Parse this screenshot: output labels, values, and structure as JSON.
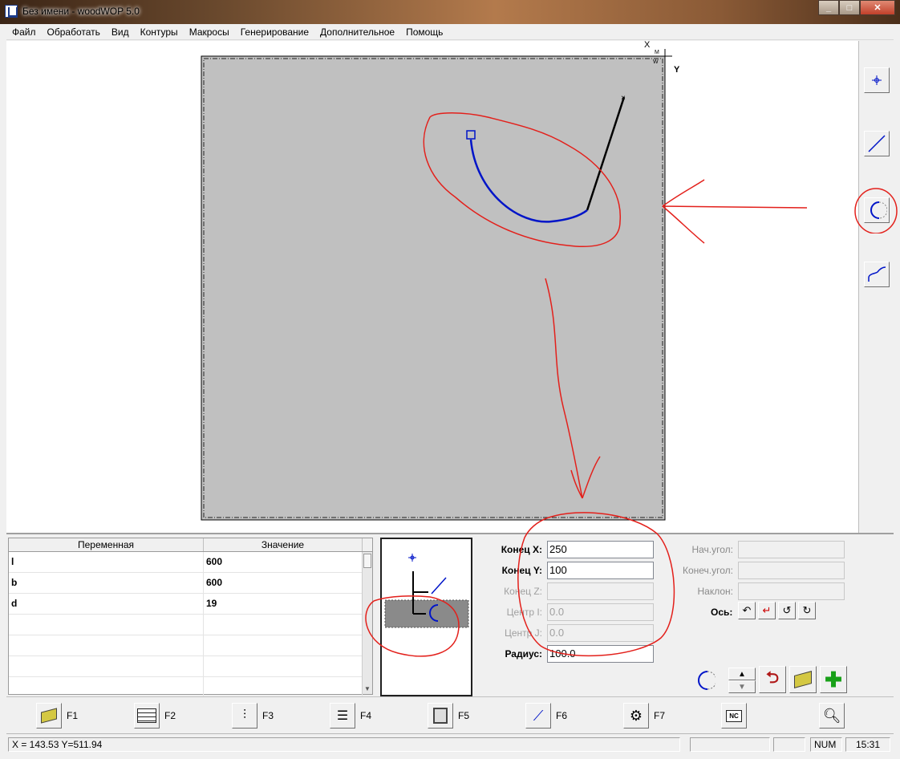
{
  "window": {
    "title": "Без имени - woodWOP 5.0"
  },
  "menu": [
    "Файл",
    "Обработать",
    "Вид",
    "Контуры",
    "Макросы",
    "Генерирование",
    "Дополнительное",
    "Помощь"
  ],
  "canvas": {
    "axis_x": "X",
    "axis_y": "Y"
  },
  "variables": {
    "headers": [
      "Переменная",
      "Значение"
    ],
    "rows": [
      {
        "name": "l",
        "value": "600"
      },
      {
        "name": "b",
        "value": "600"
      },
      {
        "name": "d",
        "value": "19"
      },
      {
        "name": "",
        "value": ""
      },
      {
        "name": "",
        "value": ""
      },
      {
        "name": "",
        "value": ""
      },
      {
        "name": "",
        "value": ""
      }
    ]
  },
  "form": {
    "end_x_label": "Конец X:",
    "end_x_value": "250",
    "end_y_label": "Конец Y:",
    "end_y_value": "100",
    "end_z_label": "Конец Z:",
    "center_i_label": "Центр I:",
    "center_i_value": "0.0",
    "center_j_label": "Центр J:",
    "center_j_value": "0.0",
    "radius_label": "Радиус:",
    "radius_value": "100.0",
    "start_angle_label": "Нач.угол:",
    "end_angle_label": "Конеч.угол:",
    "tilt_label": "Наклон:",
    "axis_label": "Ось:"
  },
  "fkeys": [
    "F1",
    "F2",
    "F3",
    "F4",
    "F5",
    "F6",
    "F7",
    "",
    ""
  ],
  "status": {
    "coords": "X = 143.53   Y=511.94",
    "num": "NUM",
    "time": "15:31"
  },
  "colors": {
    "annotation": "#e3201b",
    "arc": "#0014c8",
    "part": "#c0c0c0"
  }
}
